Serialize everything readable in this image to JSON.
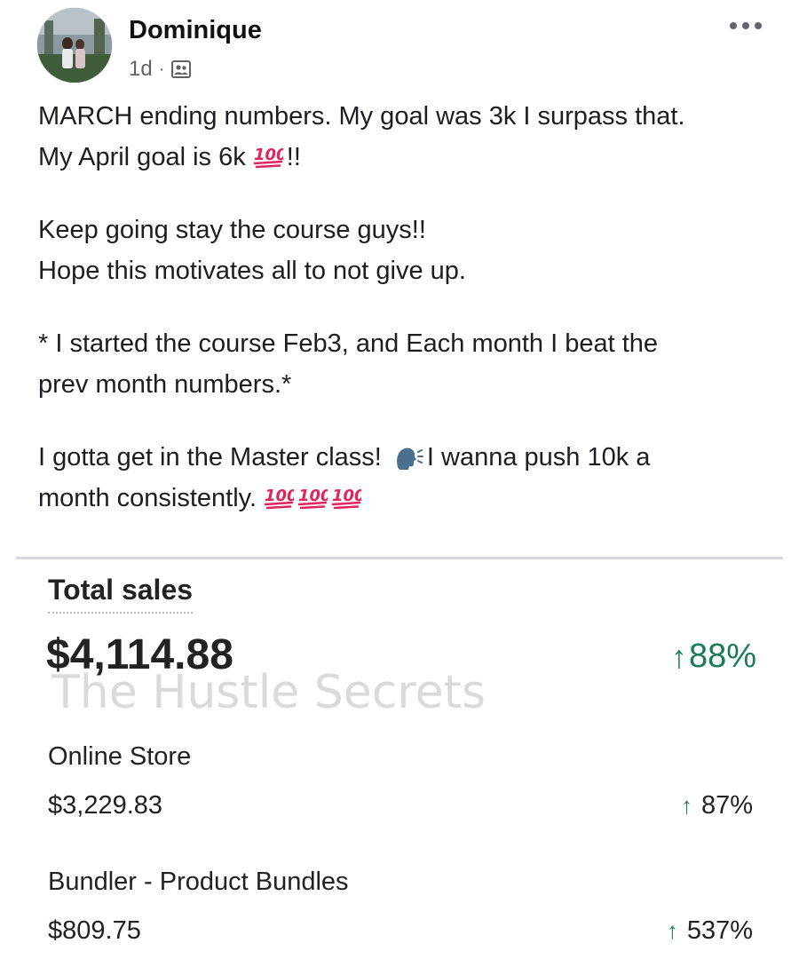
{
  "post": {
    "author": "Dominique",
    "time": "1d",
    "separator": "·",
    "privacy_icon": "group-icon",
    "more_icon": "more-options-icon",
    "body": {
      "p1_l1": "MARCH ending numbers. My goal was 3k I surpass that.",
      "p1_l2_a": "My April goal is 6k ",
      "p1_l2_b": "!!",
      "p2_l1": "Keep going stay the course guys!!",
      "p2_l2": "Hope this motivates all to not give up.",
      "p3_l1": "* I started the course Feb3, and Each month I beat the",
      "p3_l2": "prev month numbers.*",
      "p4_l1_a": "I gotta get in the Master class! ",
      "p4_l1_b": "I wanna push 10k a",
      "p4_l2": "month consistently. "
    },
    "emoji": {
      "hundred": "hundred-points-icon",
      "speaking": "speaking-head-icon"
    }
  },
  "sales": {
    "title": "Total sales",
    "total": "$4,114.88",
    "total_change": "88%",
    "watermark": "The Hustle Secrets",
    "rows": [
      {
        "label": "Online Store",
        "value": "$3,229.83",
        "change": "87%"
      },
      {
        "label": "Bundler - Product Bundles",
        "value": "$809.75",
        "change": "537%"
      }
    ],
    "colors": {
      "positive": "#1b7c58",
      "text": "#202223"
    }
  }
}
